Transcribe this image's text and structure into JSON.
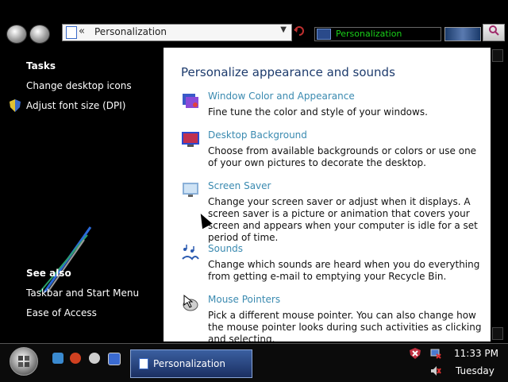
{
  "address_bar": {
    "chevron": "«",
    "breadcrumb": "Personalization",
    "dropdown": "▼",
    "refresh_icon": "refresh-icon"
  },
  "search": {
    "text": "Personalization",
    "button_icon": "search-icon"
  },
  "sidebar": {
    "tasks_heading": "Tasks",
    "tasks": [
      {
        "label": "Change desktop icons"
      },
      {
        "label": "Adjust font size (DPI)",
        "icon": "shield-icon"
      }
    ],
    "see_also_heading": "See also",
    "see_also": [
      {
        "label": "Taskbar and Start Menu"
      },
      {
        "label": "Ease of Access"
      }
    ]
  },
  "main": {
    "title": "Personalize appearance and sounds",
    "items": [
      {
        "link": "Window Color and Appearance",
        "desc": "Fine tune the color and style of your windows.",
        "icon": "window-color-icon"
      },
      {
        "link": "Desktop Background",
        "desc": "Choose from available backgrounds or colors or use one of your own pictures to decorate the desktop.",
        "icon": "desktop-background-icon"
      },
      {
        "link": "Screen Saver",
        "desc": "Change your screen saver or adjust when it displays. A screen saver is a picture or animation that covers your screen and appears when your computer is idle for a set period of time.",
        "icon": "screen-saver-icon"
      },
      {
        "link": "Sounds",
        "desc": "Change which sounds are heard when you do everything from getting e-mail to emptying your Recycle Bin.",
        "icon": "sounds-icon"
      },
      {
        "link": "Mouse Pointers",
        "desc": "Pick a different mouse pointer. You can also change how the mouse pointer looks during such activities as clicking and selecting.",
        "icon": "mouse-pointers-icon"
      }
    ]
  },
  "taskbar": {
    "task_label": "Personalization",
    "time": "11:33 PM",
    "day": "Tuesday"
  },
  "colors": {
    "link": "#3a8ab0",
    "title": "#1d3b6d",
    "taskbar": "#0b0b0b"
  }
}
